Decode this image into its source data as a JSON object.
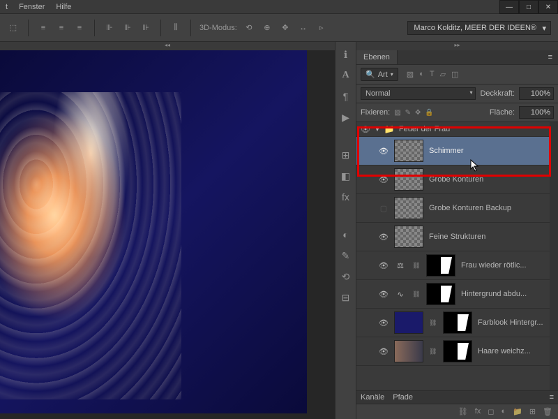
{
  "menu": {
    "fenster": "Fenster",
    "hilfe": "Hilfe"
  },
  "options": {
    "mode3d_label": "3D-Modus:",
    "preset": "Marco Kolditz, MEER DER IDEEN®"
  },
  "panel": {
    "tab_layers": "Ebenen",
    "filter_label": "Art",
    "blend_mode": "Normal",
    "opacity_label": "Deckkraft:",
    "opacity_value": "100%",
    "lock_label": "Fixieren:",
    "fill_label": "Fläche:",
    "fill_value": "100%"
  },
  "group": {
    "name": "Feuer der Frau"
  },
  "layers": [
    {
      "name": "Schimmer"
    },
    {
      "name": "Grobe Konturen"
    },
    {
      "name": "Grobe Konturen Backup"
    },
    {
      "name": "Feine Strukturen"
    },
    {
      "name": "Frau wieder rötlic..."
    },
    {
      "name": "Hintergrund abdu..."
    },
    {
      "name": "Farblook Hintergr..."
    },
    {
      "name": "Haare weichz..."
    }
  ],
  "bottom": {
    "kanaele": "Kanäle",
    "pfade": "Pfade"
  }
}
